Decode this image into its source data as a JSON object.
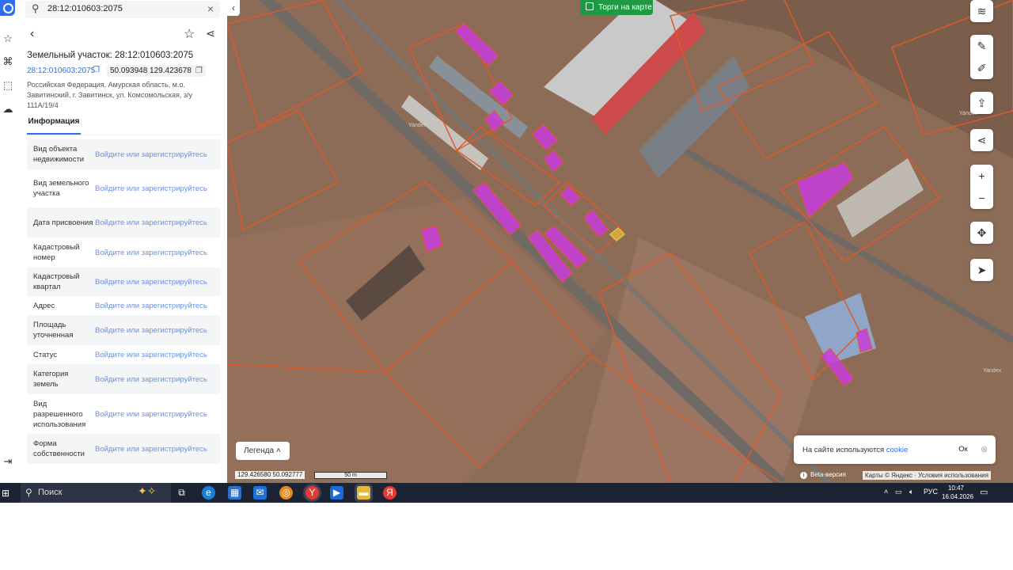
{
  "search": {
    "value": "28:12:010603:2075"
  },
  "parcel": {
    "title": "Земельный участок: 28:12:010603:2075",
    "id_link": "28:12:010603:2075",
    "coordinates": "50.093948 129.423678",
    "address": "Российская Федерация, Амурская область, м.о. Завитинский, г. Завитинск, ул. Комсомольская, з/у 111А/19/4"
  },
  "tabs": {
    "info": "Информация"
  },
  "info_rows": [
    {
      "label": "Вид объекта недвижимости",
      "value": "Войдите или зарегистрируйтесь"
    },
    {
      "label": "Вид земельного участка",
      "value": "Войдите или зарегистрируйтесь"
    },
    {
      "label": "Дата присвоения",
      "value": "Войдите или зарегистрируйтесь"
    },
    {
      "label": "Кадастровый номер",
      "value": "Войдите или зарегистрируйтесь"
    },
    {
      "label": "Кадастровый квартал",
      "value": "Войдите или зарегистрируйтесь"
    },
    {
      "label": "Адрес",
      "value": "Войдите или зарегистрируйтесь"
    },
    {
      "label": "Площадь уточненная",
      "value": "Войдите или зарегистрируйтесь"
    },
    {
      "label": "Статус",
      "value": "Войдите или зарегистрируйтесь"
    },
    {
      "label": "Категория земель",
      "value": "Войдите или зарегистрируйтесь"
    },
    {
      "label": "Вид разрешенного использования",
      "value": "Войдите или зарегистрируйтесь"
    },
    {
      "label": "Форма собственности",
      "value": "Войдите или зарегистрируйтесь"
    }
  ],
  "map": {
    "torgi_label": "Торги на карте",
    "legend_label": "Легенда",
    "cursor_coords": "129.426580  50.092777",
    "scale_label": "50 m",
    "beta_label": "Beta-версия",
    "attribution": "Карты © Яндекс · Условия использования",
    "map_watermark": "Yandex",
    "cookie": {
      "text": "На сайте используются",
      "link": "cookie",
      "ok": "Ок"
    }
  },
  "taskbar": {
    "search_label": "Поиск",
    "lang": "РУС",
    "time": "10:47",
    "date": "16.04.2026"
  },
  "colors": {
    "accent": "#2d6ff0",
    "parcel_outline": "#e0592a",
    "parcel_fill": "#c83cdc",
    "torgi_bg": "#1f9a44"
  }
}
